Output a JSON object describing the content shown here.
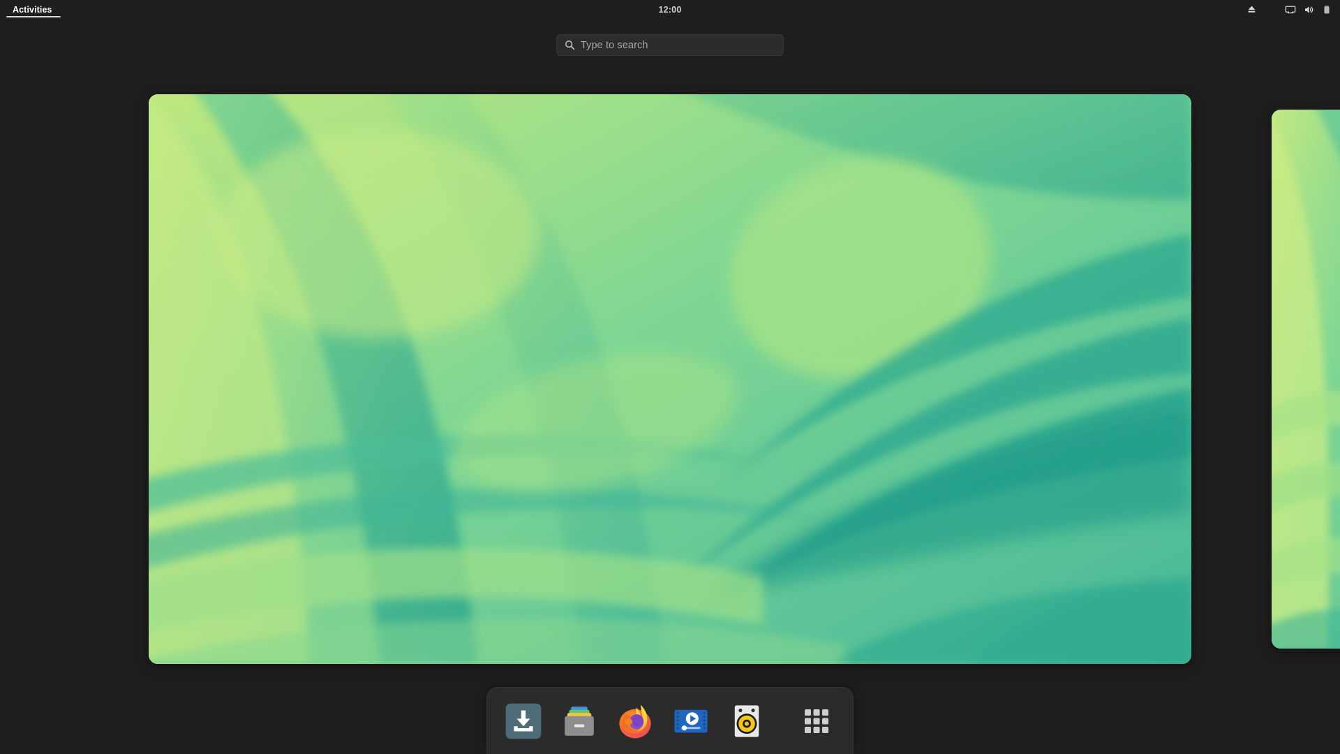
{
  "desktop": {
    "shell": "GNOME Shell",
    "mode": "activities-overview",
    "background_color": "#1e1e1e"
  },
  "topbar": {
    "activities": {
      "label": "Activities",
      "icon": "activities-indicator",
      "active": true
    },
    "clock": {
      "time": "12:00"
    },
    "status_icons": [
      {
        "name": "eject-icon",
        "label": "Eject"
      },
      {
        "name": "display-icon",
        "label": "Display"
      },
      {
        "name": "volume-icon",
        "label": "Volume"
      },
      {
        "name": "battery-icon",
        "label": "Battery"
      }
    ]
  },
  "search": {
    "placeholder": "Type to search",
    "value": "",
    "icon": "search-icon"
  },
  "workspaces": [
    {
      "name": "workspace-1",
      "active": true,
      "wallpaper": "green-abstract-contours"
    },
    {
      "name": "workspace-2",
      "active": false,
      "wallpaper": "green-abstract-contours"
    }
  ],
  "dock": {
    "items": [
      {
        "name": "dock-item-software",
        "label": "Software",
        "icon": "software-install-icon"
      },
      {
        "name": "dock-item-files",
        "label": "Files",
        "icon": "file-cabinet-icon"
      },
      {
        "name": "dock-item-firefox",
        "label": "Firefox",
        "icon": "firefox-icon"
      },
      {
        "name": "dock-item-videos",
        "label": "Videos",
        "icon": "video-player-icon"
      },
      {
        "name": "dock-item-rhythmbox",
        "label": "Rhythmbox",
        "icon": "speaker-icon"
      }
    ],
    "app_grid": {
      "name": "app-grid-button",
      "label": "Show Applications",
      "icon": "grid-icon"
    }
  },
  "colors": {
    "panel_bg": "#1e1e1e",
    "dock_bg": "#2b2b2b",
    "search_bg": "#2c2c2c",
    "text_primary": "#ffffff",
    "text_secondary": "#a8a8a8",
    "wallpaper_light": "#b5e682",
    "wallpaper_mid": "#6ece90",
    "wallpaper_deep": "#2aa58f"
  }
}
